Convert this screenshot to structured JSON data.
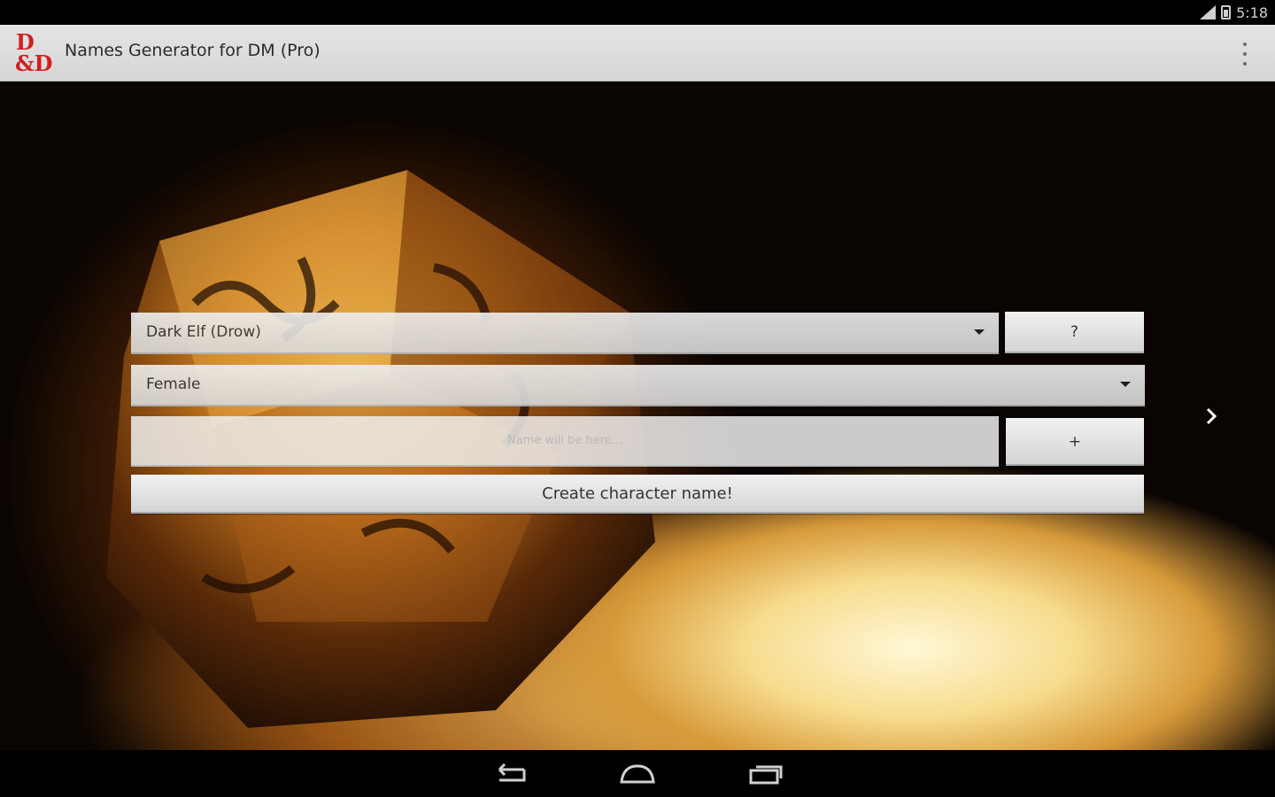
{
  "status_bar": {
    "time": "5:18"
  },
  "app": {
    "logo_line1": "D",
    "logo_line2": "&D",
    "title": "Names Generator for DM (Pro)"
  },
  "form": {
    "race_select": {
      "value": "Dark Elf (Drow)"
    },
    "help_button": "?",
    "gender_select": {
      "value": "Female"
    },
    "name_output": {
      "placeholder": "Name will be here..."
    },
    "add_button": "+",
    "create_button": "Create character name!"
  },
  "icons": {
    "overflow": "overflow-menu-icon",
    "next": "chevron-right-icon",
    "back": "back-icon",
    "home": "home-icon",
    "recents": "recents-icon"
  },
  "colors": {
    "logo_red": "#d21f1f",
    "action_bar": "#dcdcdc"
  }
}
